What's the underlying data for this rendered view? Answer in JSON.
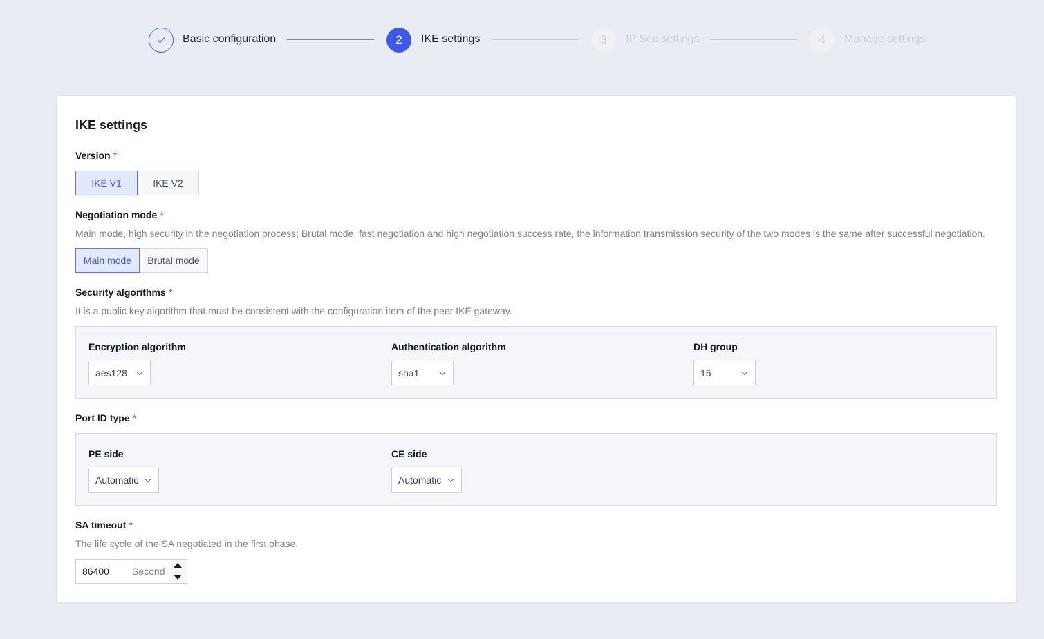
{
  "stepper": {
    "steps": [
      {
        "number": "",
        "label": "Basic configuration",
        "state": "done"
      },
      {
        "number": "2",
        "label": "IKE settings",
        "state": "active"
      },
      {
        "number": "3",
        "label": "IP Sec settings",
        "state": "todo"
      },
      {
        "number": "4",
        "label": "Manage settings",
        "state": "todo"
      }
    ]
  },
  "card": {
    "title": "IKE settings",
    "version": {
      "label": "Version",
      "options": [
        "IKE V1",
        "IKE V2"
      ],
      "selected": "IKE V1"
    },
    "negotiation_mode": {
      "label": "Negotiation mode",
      "hint": "Main mode, high security in the negotiation process; Brutal mode, fast negotiation and high negotiation success rate, the information transmission security of the two modes is the same after successful negotiation.",
      "options": [
        "Main mode",
        "Brutal mode"
      ],
      "selected": "Main mode"
    },
    "security_algorithms": {
      "label": "Security algorithms",
      "hint": "It is a public key algorithm that must be consistent with the configuration item of the peer IKE gateway.",
      "encryption": {
        "label": "Encryption algorithm",
        "value": "aes128"
      },
      "authentication": {
        "label": "Authentication algorithm",
        "value": "sha1"
      },
      "dh_group": {
        "label": "DH group",
        "value": "15"
      }
    },
    "port_id_type": {
      "label": "Port ID type",
      "pe_side": {
        "label": "PE side",
        "value": "Automatic"
      },
      "ce_side": {
        "label": "CE side",
        "value": "Automatic"
      }
    },
    "sa_timeout": {
      "label": "SA timeout",
      "hint": "The life cycle of the SA negotiated in the first phase.",
      "value": "86400",
      "unit": "Second"
    },
    "required_mark": "*"
  },
  "colors": {
    "accent": "#3c5ae6",
    "selected_bg": "#e3e9fd",
    "page_bg": "#eaecf3",
    "required": "#e5484d",
    "muted": "#c9ccd6"
  },
  "icons": {
    "step1": "check-icon",
    "select": "chevron-down-icon",
    "stepper_up": "caret-up-icon",
    "stepper_down": "caret-down-icon"
  }
}
